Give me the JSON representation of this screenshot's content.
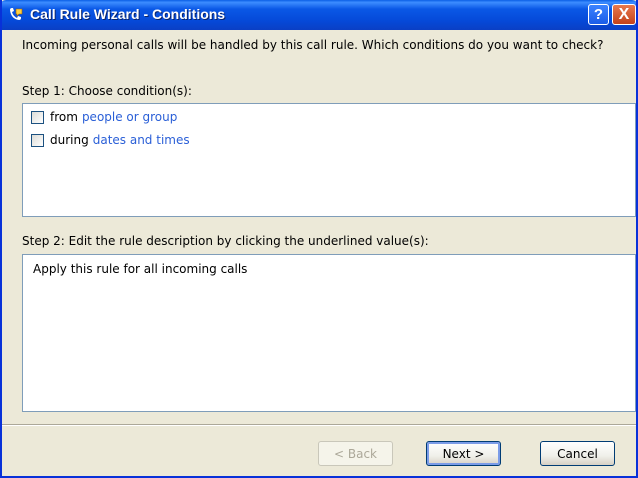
{
  "window": {
    "title": "Call Rule Wizard - Conditions",
    "help_label": "?",
    "close_label": "X"
  },
  "intro_text": "Incoming personal calls will be handled by this call rule.  Which conditions do you want to check?",
  "step1": {
    "label": "Step 1: Choose condition(s):",
    "conditions": [
      {
        "prefix": "from",
        "link": "people or group",
        "checked": false
      },
      {
        "prefix": "during",
        "link": "dates and times",
        "checked": false
      }
    ]
  },
  "step2": {
    "label": "Step 2:  Edit the rule description by clicking the underlined value(s):",
    "description": "Apply this rule for all incoming calls"
  },
  "buttons": {
    "back": "< Back",
    "next": "Next >",
    "cancel": "Cancel"
  },
  "colors": {
    "title_bar": "#0a58e6",
    "link": "#2a5fd7",
    "dialog_bg": "#ece9d8"
  }
}
